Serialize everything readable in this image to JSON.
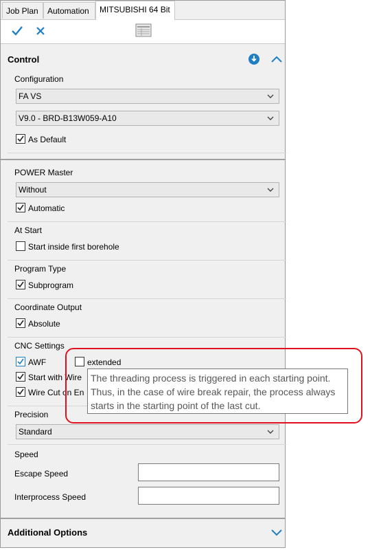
{
  "tabs": [
    "Job Plan",
    "Automation",
    "MITSUBISHI 64 Bit"
  ],
  "toolbar": {
    "confirm_icon": "check-icon",
    "cancel_icon": "close-icon",
    "table_icon": "table-icon"
  },
  "control": {
    "title": "Control",
    "configuration_label": "Configuration",
    "config_value": "FA VS",
    "version_value": "V9.0 - BRD-B13W059-A10",
    "as_default_label": "As Default",
    "as_default_checked": true
  },
  "power_master": {
    "label": "POWER Master",
    "value": "Without",
    "automatic_label": "Automatic",
    "automatic_checked": true
  },
  "at_start": {
    "label": "At Start",
    "option_label": "Start inside first borehole",
    "option_checked": false
  },
  "program_type": {
    "label": "Program Type",
    "option_label": "Subprogram",
    "option_checked": true
  },
  "coordinate_output": {
    "label": "Coordinate Output",
    "option_label": "Absolute",
    "option_checked": true
  },
  "cnc_settings": {
    "label": "CNC Settings",
    "awf_label": "AWF",
    "extended_label": "extended",
    "start_with_wire_label": "Start with Wire",
    "wire_cut_label": "Wire Cut on En"
  },
  "tooltip": {
    "line1": "The threading process is triggered in each starting point.",
    "line2": "Thus, in the case of wire break repair, the process always",
    "line3": "starts in the starting point of the last cut."
  },
  "precision": {
    "label": "Precision",
    "value": "Standard"
  },
  "speed": {
    "label": "Speed",
    "escape_label": "Escape Speed",
    "escape_value": "",
    "interprocess_label": "Interprocess Speed",
    "interprocess_value": ""
  },
  "additional_options": {
    "title": "Additional Options"
  },
  "colors": {
    "accent": "#1e7fc4",
    "highlight_box": "#e0111c"
  }
}
